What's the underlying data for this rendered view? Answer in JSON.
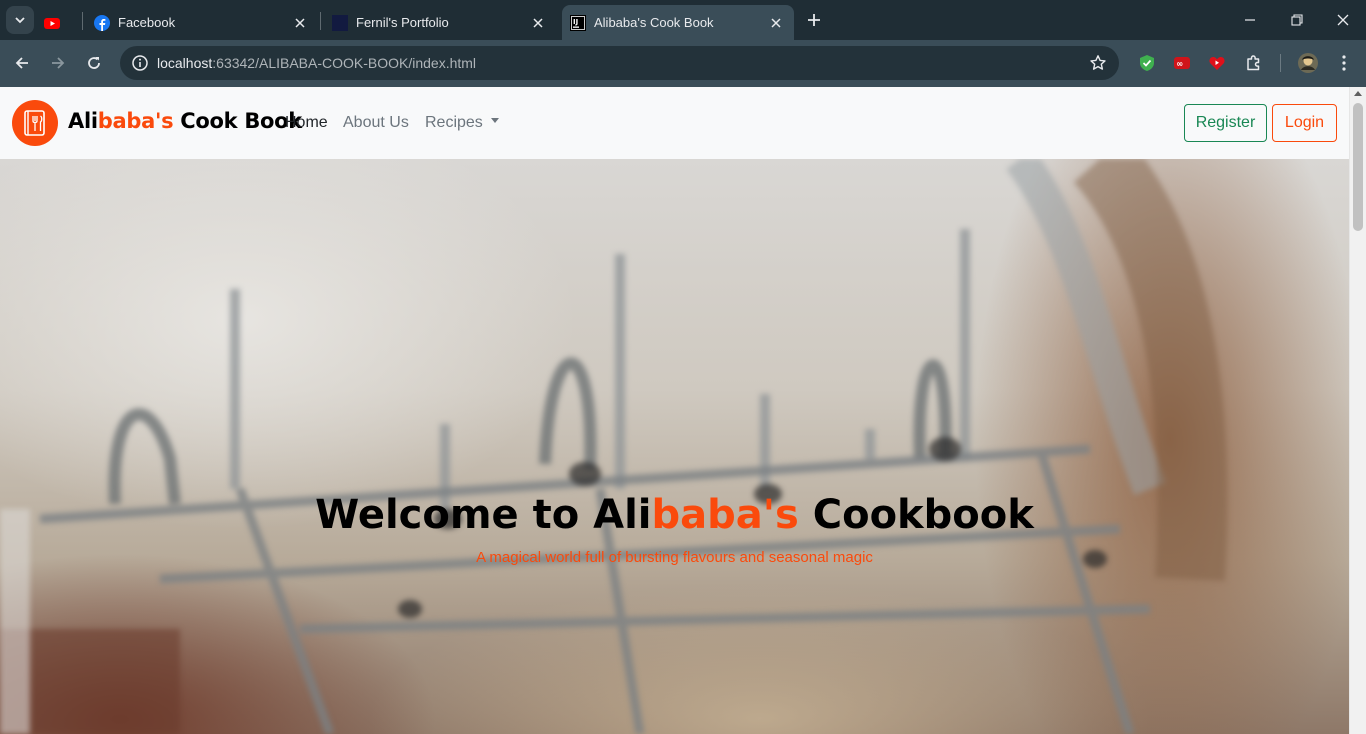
{
  "browser": {
    "tabs": [
      {
        "title": "",
        "icon": "youtube-icon"
      },
      {
        "title": "Facebook",
        "icon": "facebook-icon"
      },
      {
        "title": "Fernil's Portfolio",
        "icon": "portfolio-icon"
      },
      {
        "title": "Alibaba's Cook Book",
        "icon": "intellij-icon",
        "active": true
      }
    ],
    "url": {
      "host": "localhost",
      "rest": ":63342/ALIBABA-COOK-BOOK/index.html"
    },
    "extensions": [
      "shield-extension-icon",
      "infinity-extension-icon",
      "heart-extension-icon",
      "puzzle-extensions-icon",
      "profile-avatar-icon"
    ]
  },
  "site": {
    "brand": {
      "part1": "Ali",
      "part2": "baba's",
      "part3": " Cook Book"
    },
    "nav": {
      "home": "Home",
      "about": "About Us",
      "recipes": "Recipes"
    },
    "buttons": {
      "register": "Register",
      "login": "Login"
    },
    "hero": {
      "title_part1": "Welcome to Ali",
      "title_part2": "baba's",
      "title_part3": " Cookbook",
      "subtitle": "A magical world full of bursting flavours and seasonal magic"
    }
  },
  "colors": {
    "accent": "#fa4a0c",
    "register": "#198754",
    "navbar": "#f8f9fa"
  }
}
